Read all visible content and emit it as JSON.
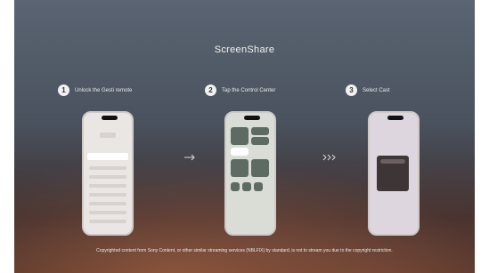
{
  "title": "ScreenShare",
  "steps": [
    {
      "number": "1",
      "text": "Unlock the Gesti remote"
    },
    {
      "number": "2",
      "text": "Tap the Control Center"
    },
    {
      "number": "3",
      "text": "Select Cast"
    }
  ],
  "caption": "Copyrighted content from Sony Content, or other similar streaming services (NBLFIX) by standard, is not to stream you due to the copyright restriction.",
  "icons": [
    "right-arrow-icon",
    "cast-icon"
  ]
}
